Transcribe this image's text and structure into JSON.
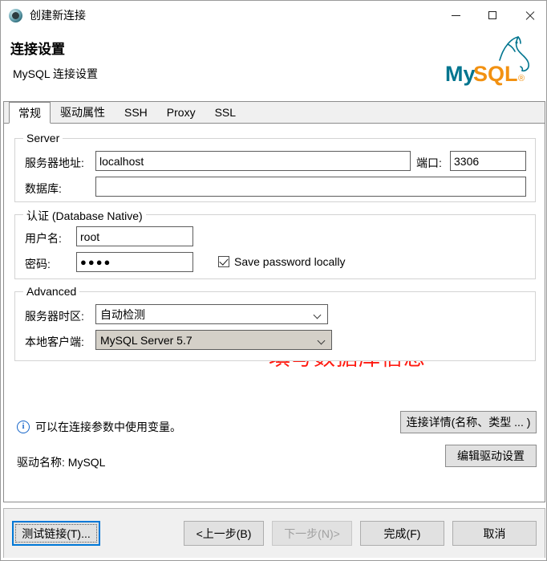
{
  "window": {
    "title": "创建新连接",
    "icon": "dbeaver-icon",
    "controls": {
      "minimize": "minimize-icon",
      "maximize": "maximize-icon",
      "close": "close-icon"
    }
  },
  "header": {
    "title": "连接设置",
    "subtitle": "MySQL 连接设置",
    "logo_text_primary": "My",
    "logo_text_secondary": "SQL",
    "logo_registered": "®",
    "logo_color_primary": "#00758f",
    "logo_color_secondary": "#f29111"
  },
  "tabs": [
    {
      "label": "常规",
      "active": true
    },
    {
      "label": "驱动属性",
      "active": false
    },
    {
      "label": "SSH",
      "active": false
    },
    {
      "label": "Proxy",
      "active": false
    },
    {
      "label": "SSL",
      "active": false
    }
  ],
  "server_group": {
    "title": "Server",
    "host_label": "服务器地址:",
    "host_value": "localhost",
    "port_label": "端口:",
    "port_value": "3306",
    "database_label": "数据库:",
    "database_value": ""
  },
  "auth_group": {
    "title": "认证 (Database Native)",
    "username_label": "用户名:",
    "username_value": "root",
    "password_label": "密码:",
    "password_value": "●●●●",
    "save_password_label": "Save password locally",
    "save_password_checked": true
  },
  "advanced_group": {
    "title": "Advanced",
    "timezone_label": "服务器时区:",
    "timezone_value": "自动检测",
    "client_label": "本地客户端:",
    "client_value": "MySQL Server 5.7"
  },
  "annotation": {
    "text": "填写数据库信息",
    "color": "#ff1a10"
  },
  "info": {
    "icon": "info-icon",
    "text": "可以在连接参数中使用变量。"
  },
  "driver": {
    "label": "驱动名称: MySQL"
  },
  "buttons": {
    "connection_details": "连接详情(名称、类型 ... )",
    "edit_driver": "编辑驱动设置"
  },
  "footer": {
    "test_connection": "测试链接(T)...",
    "back": "<上一步(B)",
    "next": "下一步(N)>",
    "finish": "完成(F)",
    "cancel": "取消",
    "next_disabled": true,
    "test_focused": true
  }
}
